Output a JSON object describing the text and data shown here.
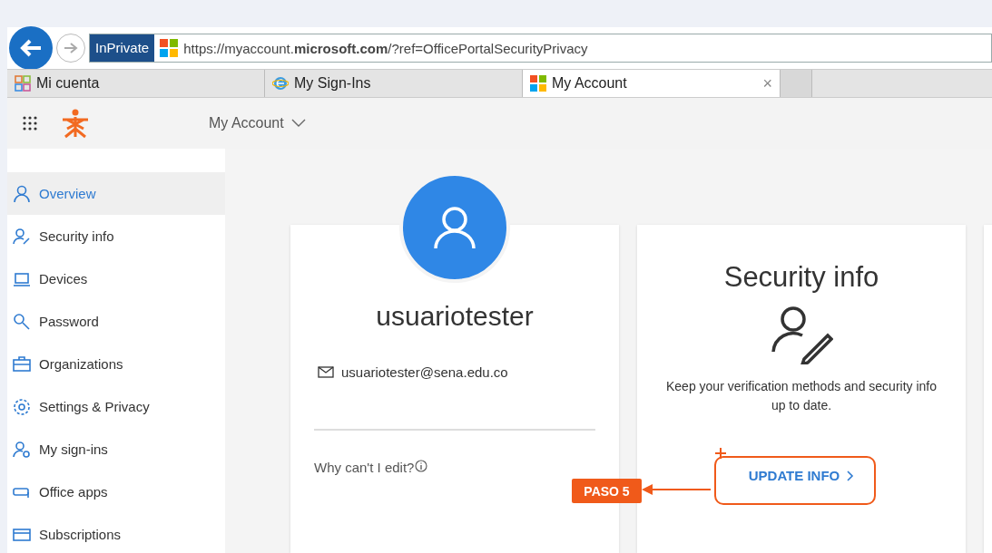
{
  "browser": {
    "private_badge": "InPrivate",
    "url": "https://myaccount.**microsoft.com**/?ref=OfficePortalSecurityPrivacy"
  },
  "tabs": [
    {
      "label": "Mi cuenta",
      "selected": false
    },
    {
      "label": "My Sign-Ins",
      "selected": false
    },
    {
      "label": "My Account",
      "selected": true,
      "close": "×"
    }
  ],
  "header": {
    "title": "My Account"
  },
  "sidebar": {
    "items": [
      {
        "label": "Overview",
        "selected": true
      },
      {
        "label": "Security info",
        "selected": false
      },
      {
        "label": "Devices",
        "selected": false
      },
      {
        "label": "Password",
        "selected": false
      },
      {
        "label": "Organizations",
        "selected": false
      },
      {
        "label": "Settings & Privacy",
        "selected": false
      },
      {
        "label": "My sign-ins",
        "selected": false
      },
      {
        "label": "Office apps",
        "selected": false
      },
      {
        "label": "Subscriptions",
        "selected": false
      }
    ]
  },
  "profile_card": {
    "username": "usuariotester",
    "email": "usuariotester@sena.edu.co",
    "help_link": "Why can't I edit?"
  },
  "security_card": {
    "title": "Security info",
    "description": "Keep your verification methods and security info up to date.",
    "button": "UPDATE INFO"
  },
  "annotation": {
    "label": "PASO 5"
  }
}
